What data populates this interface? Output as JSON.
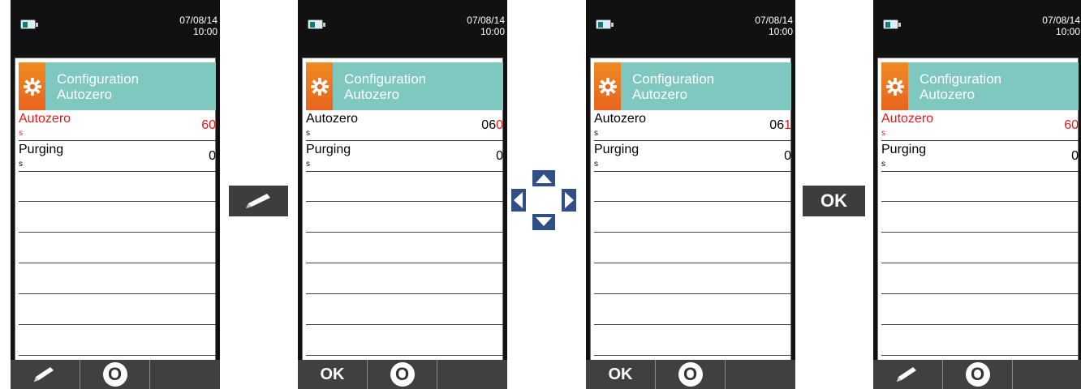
{
  "screens": [
    {
      "datetime": {
        "date": "07/08/14",
        "time": "10:00"
      },
      "header": {
        "line1": "Configuration",
        "line2": "Autozero",
        "icon": "gear-icon"
      },
      "rows": [
        {
          "label": "Autozero",
          "unit": "s",
          "value": "60",
          "selected": true
        },
        {
          "label": "Purging",
          "unit": "s",
          "value": "0",
          "selected": false
        }
      ],
      "softkeys": [
        {
          "type": "icon",
          "icon": "pencil-icon"
        },
        {
          "type": "power",
          "icon": "power-icon",
          "text": "O"
        },
        {
          "type": "blank"
        }
      ]
    },
    {
      "datetime": {
        "date": "07/08/14",
        "time": "10:00"
      },
      "header": {
        "line1": "Configuration",
        "line2": "Autozero",
        "icon": "gear-icon"
      },
      "rows": [
        {
          "label": "Autozero",
          "unit": "s",
          "value_prefix": "06",
          "value_active": "0",
          "selected": false
        },
        {
          "label": "Purging",
          "unit": "s",
          "value": "0",
          "selected": false
        }
      ],
      "softkeys": [
        {
          "type": "text",
          "text": "OK"
        },
        {
          "type": "power",
          "icon": "power-icon",
          "text": "O"
        },
        {
          "type": "blank"
        }
      ]
    },
    {
      "datetime": {
        "date": "07/08/14",
        "time": "10:00"
      },
      "header": {
        "line1": "Configuration",
        "line2": "Autozero",
        "icon": "gear-icon"
      },
      "rows": [
        {
          "label": "Autozero",
          "unit": "s",
          "value_prefix": "06",
          "value_active": "1",
          "selected": false
        },
        {
          "label": "Purging",
          "unit": "s",
          "value": "0",
          "selected": false
        }
      ],
      "softkeys": [
        {
          "type": "text",
          "text": "OK"
        },
        {
          "type": "power",
          "icon": "power-icon",
          "text": "O"
        },
        {
          "type": "blank"
        }
      ]
    },
    {
      "datetime": {
        "date": "07/08/14",
        "time": "10:00"
      },
      "header": {
        "line1": "Configuration",
        "line2": "Autozero",
        "icon": "gear-icon"
      },
      "rows": [
        {
          "label": "Autozero",
          "unit": "s",
          "value": "60",
          "selected": true
        },
        {
          "label": "Purging",
          "unit": "s",
          "value": "0",
          "selected": false
        }
      ],
      "softkeys": [
        {
          "type": "icon",
          "icon": "pencil-icon"
        },
        {
          "type": "power",
          "icon": "power-icon",
          "text": "O"
        },
        {
          "type": "blank"
        }
      ]
    }
  ],
  "actions": {
    "edit": {
      "icon": "pencil-icon"
    },
    "navigate": {
      "icon": "dpad-icon"
    },
    "confirm": {
      "label": "OK"
    }
  },
  "colors": {
    "header": "#7fc8c0",
    "header_icon": "#f08a22",
    "selected_text": "#e8171a",
    "device_body": "#111111",
    "softkey_bar": "#404040",
    "action_key": "#3d3d3d",
    "dpad": "#2f4f86"
  }
}
